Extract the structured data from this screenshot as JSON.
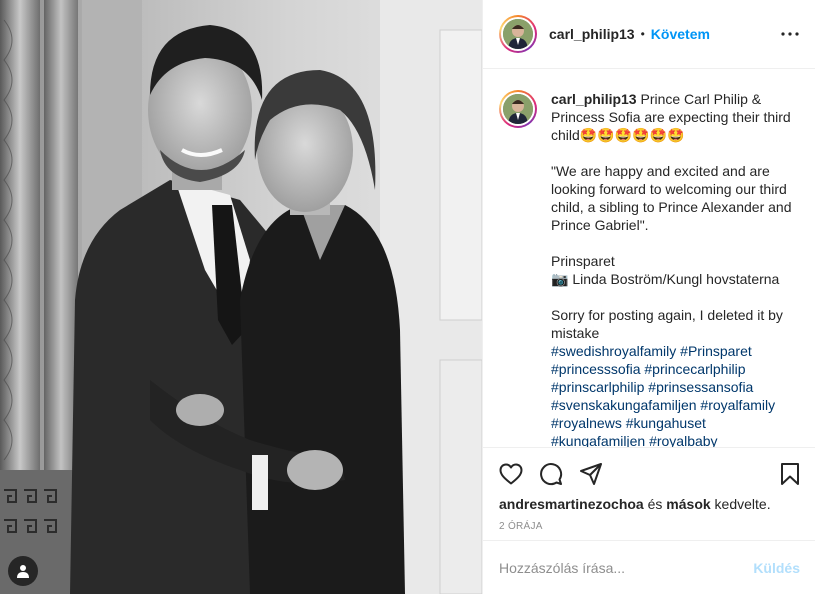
{
  "post": {
    "author": {
      "username": "carl_philip13",
      "follow_label": "Követem",
      "separator": "•"
    },
    "caption": {
      "username": "carl_philip13",
      "line1": "Prince Carl Philip & Princess Sofia are expecting their third child🤩🤩🤩🤩🤩🤩",
      "quote": "\"We are happy and excited and are looking forward to welcoming our third child, a sibling to Prince Alexander and Prince Gabriel\".",
      "signature": "Prinsparet",
      "photo_credit": "📷 Linda Boström/Kungl hovstaterna",
      "note": "Sorry for posting again, I deleted it by mistake",
      "hashtags": [
        "#swedishroyalfamily",
        "#Prinsparet",
        "#princesssofia",
        "#princecarlphilip",
        "#prinscarlphilip",
        "#prinsessansofia",
        "#svenskakungafamiljen",
        "#royalfamily",
        "#royalnews",
        "#kungahuset",
        "#kungafamiljen",
        "#royalbaby"
      ]
    },
    "likes": {
      "user": "andresmartinezochoa",
      "connector": "és",
      "others": "mások",
      "suffix": "kedvelte."
    },
    "timestamp": "2 ÓRÁJA",
    "comment": {
      "placeholder": "Hozzászólás írása...",
      "send_label": "Küldés"
    }
  },
  "icons": {
    "more": "more-options-icon",
    "like": "heart-icon",
    "comment": "comment-icon",
    "share": "paper-plane-icon",
    "save": "bookmark-icon",
    "tags": "user-tag-icon"
  },
  "colors": {
    "accent": "#0095f6",
    "hashtag": "#00376b",
    "muted": "#8e8e8e",
    "send_disabled": "#b2dffc",
    "border": "#efefef"
  }
}
